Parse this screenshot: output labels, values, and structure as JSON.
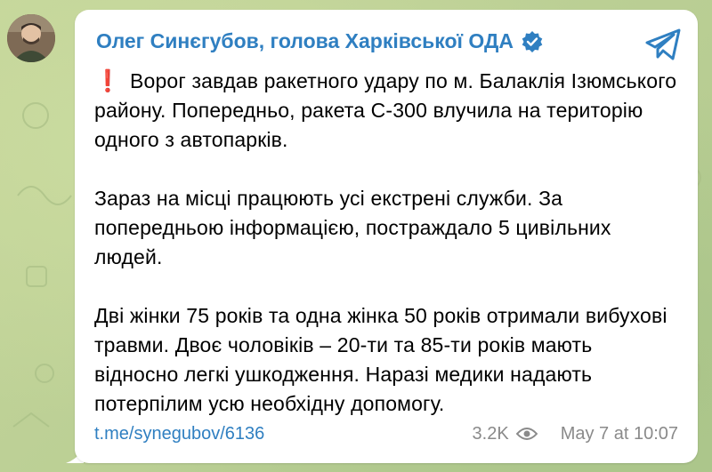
{
  "channel": {
    "sender_name": "Олег Синєгубов, голова Харківської ОДА",
    "verified_icon": "verified-badge-icon",
    "share_icon": "telegram-share-icon"
  },
  "message": {
    "exclamation": "❗",
    "paragraphs": [
      "Ворог завдав ракетного удару по м. Балаклія Ізюмського району. Попередньо, ракета С-300 влучила на територію одного з автопарків.",
      "Зараз на місці працюють усі екстрені служби. За попередньою інформацією, постраждало 5 цивільних людей.",
      "Дві жінки 75 років та одна жінка 50 років отримали вибухові травми. Двоє чоловіків – 20-ти та 85-ти років мають відносно легкі ушкодження. Наразі медики надають потерпілим усю необхідну допомогу."
    ],
    "link": "t.me/synegubov/6136",
    "views": "3.2K",
    "timestamp": "May 7 at 10:07"
  },
  "colors": {
    "accent": "#2f7fc1",
    "exclamation": "#e02020",
    "meta": "#8a8a8a"
  }
}
